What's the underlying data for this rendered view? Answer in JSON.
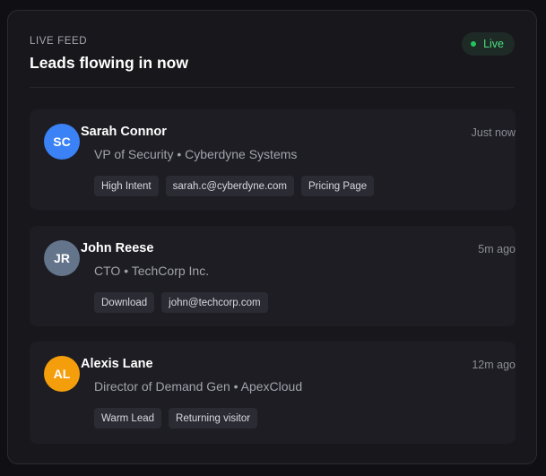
{
  "header": {
    "kicker": "LIVE FEED",
    "title": "Leads flowing in now",
    "live_label": "Live",
    "live_color": "#22c55e"
  },
  "leads": [
    {
      "initials": "SC",
      "avatar_color": "#3b82f6",
      "name": "Sarah Connor",
      "subtitle": "VP of Security • Cyberdyne Systems",
      "time": "Just now",
      "tags": [
        "High Intent",
        "sarah.c@cyberdyne.com",
        "Pricing Page"
      ]
    },
    {
      "initials": "JR",
      "avatar_color": "#64748b",
      "name": "John Reese",
      "subtitle": "CTO • TechCorp Inc.",
      "time": "5m ago",
      "tags": [
        "Download",
        "john@techcorp.com"
      ]
    },
    {
      "initials": "AL",
      "avatar_color": "#f59e0b",
      "name": "Alexis Lane",
      "subtitle": "Director of Demand Gen • ApexCloud",
      "time": "12m ago",
      "tags": [
        "Warm Lead",
        "Returning visitor"
      ]
    }
  ]
}
